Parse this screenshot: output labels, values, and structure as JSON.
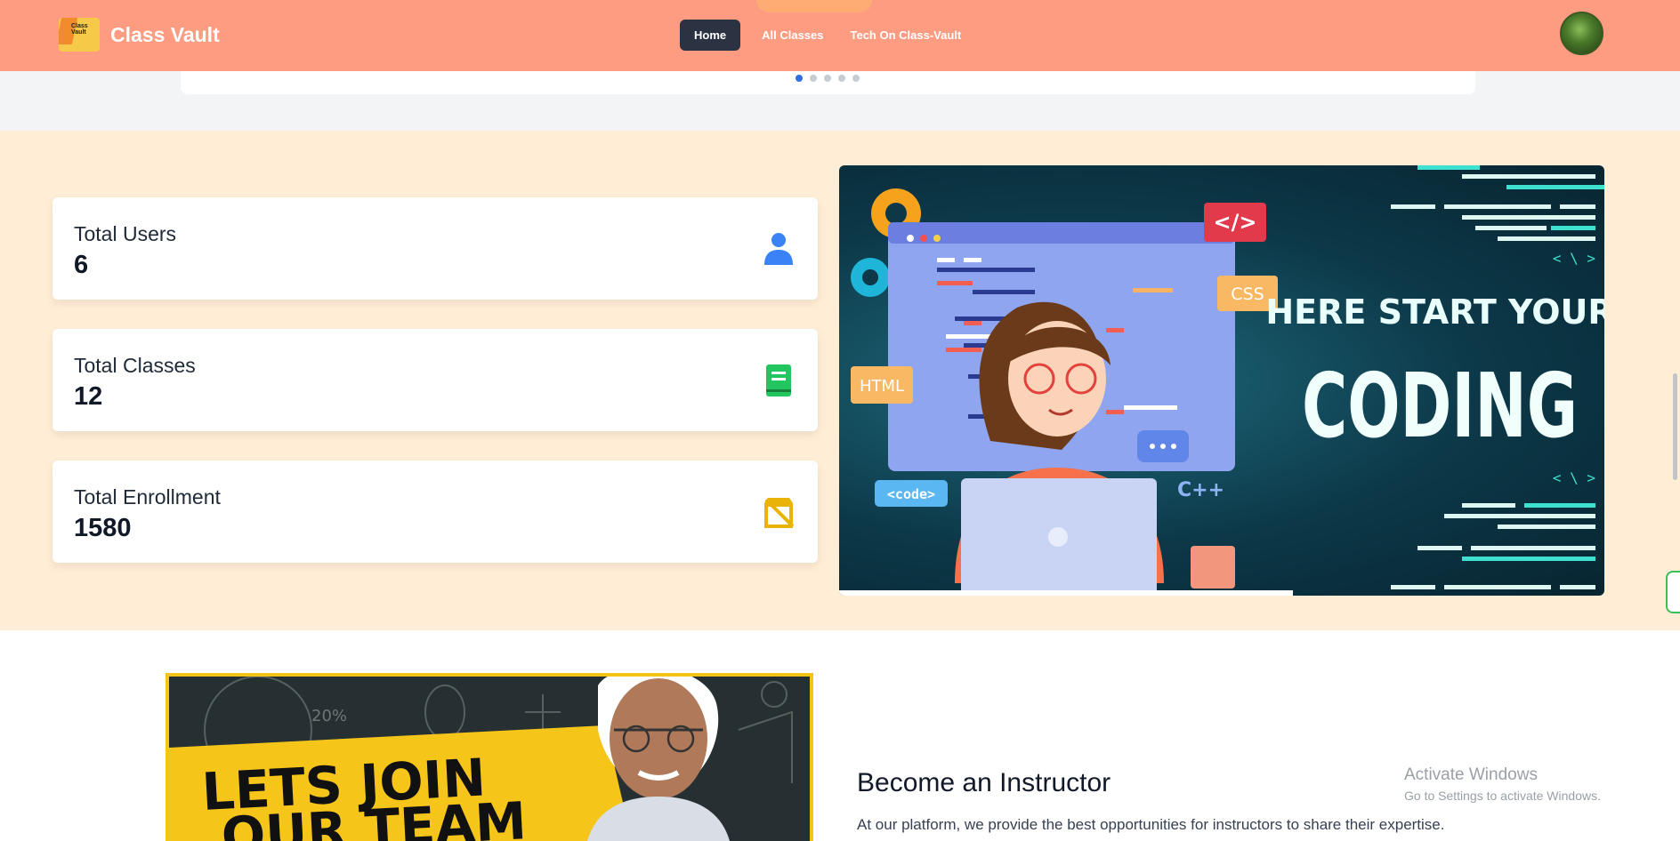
{
  "navbar": {
    "brand_name": "Class Vault",
    "logo_text": "Class Vault",
    "links": [
      {
        "label": "Home",
        "active": true
      },
      {
        "label": "All Classes",
        "active": false
      },
      {
        "label": "Tech On Class-Vault",
        "active": false
      }
    ]
  },
  "slider": {
    "dots": 5,
    "active_index": 0
  },
  "stats": [
    {
      "title": "Total Users",
      "value": "6",
      "icon": "user-icon",
      "color": "#3b82f6"
    },
    {
      "title": "Total Classes",
      "value": "12",
      "icon": "book-icon",
      "color": "#22c55e"
    },
    {
      "title": "Total Enrollment",
      "value": "1580",
      "icon": "enrollment-icon",
      "color": "#eab308"
    }
  ],
  "banner": {
    "headline_top": "HERE START YOUR",
    "headline_main": "CODING",
    "tags": {
      "code_tag": "</>",
      "css": "CSS",
      "html": "HTML",
      "code": "<code>",
      "cpp": "C++"
    }
  },
  "instructor": {
    "image_text": "LETS JOIN",
    "image_text_2": "OUR TEAM",
    "image_chalk": "20%",
    "title": "Become an Instructor",
    "description": "At our platform, we provide the best opportunities for instructors to share their expertise."
  },
  "system": {
    "activate_title": "Activate Windows",
    "activate_subtitle": "Go to Settings to activate Windows."
  }
}
